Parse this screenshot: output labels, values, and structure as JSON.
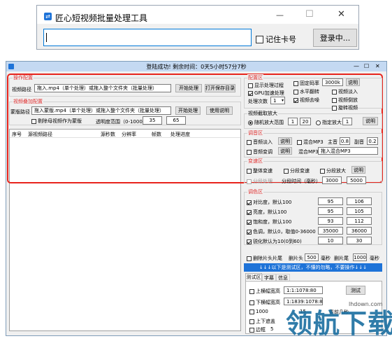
{
  "login_window": {
    "title": "匠心短视频批量处理工具",
    "controls": {
      "minimize": "—",
      "maximize": "☐",
      "close": "✕"
    },
    "card_input_value": "",
    "remember_label": "记住卡号",
    "remember_checked": false,
    "login_button": "登录中..."
  },
  "main_window": {
    "status_title": "登陆成功! 剩余时间：0天5小时57分7秒",
    "single": {
      "title": "操作配置",
      "path_label": "视频路径",
      "path_value": "拖入.mp4（单个处理）或拖入整个文件夹（批量处理）",
      "start_button": "开始处理",
      "open_dir_button": "打开保存目录"
    },
    "overlay": {
      "title": "视频叠加配置",
      "path_label": "蒙版路径",
      "path_value": "拖入蒙版.mp4（单个处理）或拖入整个文件夹（批量处理）",
      "start_button": "开始处理",
      "usage_button": "使用说明",
      "copy_label": "剔除母视频作为蒙版",
      "opacity_label": "透明度范围（0-1000）",
      "opacity_min": "35",
      "opacity_max": "65"
    },
    "table": {
      "columns": [
        "序号",
        "源视频路径",
        "源秒数",
        "分辨率",
        "帧数",
        "处理进度"
      ],
      "rows": []
    },
    "config": {
      "title": "配置区",
      "show_process_label": "显示处理过程",
      "show_process_checked": false,
      "gpu_label": "GPU加速处理",
      "gpu_checked": true,
      "count_label": "处理次数",
      "count_value": "1",
      "fixed_bitrate_label": "固定码率",
      "fixed_bitrate_checked": false,
      "bitrate_value": "3000k",
      "bitrate_help_button": "说明",
      "blur_label": "水平翻转",
      "blur_checked": false,
      "fade_in_label": "视频淡入",
      "fade_in_checked": false,
      "remove_title_label": "视频去噪",
      "remove_title_checked": true,
      "reverse_label": "视频倒放",
      "reverse_checked": false,
      "rotate_label": "旋转视频",
      "rotate_checked": false
    },
    "enlarge": {
      "title": "视频截取放大",
      "random_label": "随机放大范围",
      "random_checked": true,
      "random_min": "1",
      "random_max": "20",
      "fixed_label": "指定放大",
      "fixed_checked": false,
      "fixed_value": "1",
      "help_button": "说明"
    },
    "audio": {
      "title": "调音区",
      "audio_in_label": "音频淡入",
      "audio_in_checked": false,
      "audio_in_help": "说明",
      "mix_label": "混合MP3",
      "mix_checked": false,
      "main_label": "主音",
      "main_value": "0.8",
      "sub_label": "副音",
      "sub_value": "0.2",
      "audio_pitch_label": "音频变调",
      "audio_pitch_checked": false,
      "audio_pitch_help": "说明",
      "mix_mp3_label": "混合MP3",
      "mix_mp3_value": "拖入混合MP3"
    },
    "speed": {
      "title": "变速区",
      "global_label": "整体变速",
      "global_checked": false,
      "segment_label": "分段变速",
      "segment_checked": false,
      "segment_enlarge_label": "分段放大",
      "segment_enlarge_checked": false,
      "help_button": "说明",
      "segment_process_label": "分段处理",
      "segment_time_label": "分段时间（毫秒）",
      "segment_min": "3000",
      "segment_max": "5000"
    },
    "color": {
      "title": "调色区",
      "items": [
        {
          "label": "对比度，默认100",
          "checked": true,
          "min": "95",
          "max": "106"
        },
        {
          "label": "亮度，默认100",
          "checked": true,
          "min": "95",
          "max": "105"
        },
        {
          "label": "饱和度，默认100",
          "checked": true,
          "min": "93",
          "max": "112"
        },
        {
          "label": "色调，默认0，取值0-36000",
          "checked": true,
          "min": "35000",
          "max": "36000"
        },
        {
          "label": "锐化默认为10(0到60)",
          "checked": true,
          "min": "10",
          "max": "30"
        }
      ]
    },
    "trim": {
      "label": "删除片头片尾",
      "checked": false,
      "head_label": "删片头",
      "head_value": "500",
      "head_unit": "毫秒",
      "tail_label": "删片尾",
      "tail_value": "1000",
      "tail_unit": "毫秒"
    },
    "test_banner": "↓↓↓以下是测试区，不懂的勿略，不要操作↓↓↓",
    "test_tabs": [
      "测试区",
      "字幕",
      "信息"
    ],
    "test": {
      "top_label": "上横幅宽高",
      "top_value": "1:1:1078:80",
      "bottom_label": "下横幅宽高",
      "bottom_value": "1:1839:1078:80",
      "test_button": "测试",
      "row3_label": "1000",
      "row3_extra": "15",
      "row3_tail": "素前几秒",
      "row4_label": "上下遮盖",
      "row5_label": "边框",
      "row5_extra": "5"
    },
    "watermark": {
      "brand": "领航下载",
      "url": "lhdown.com"
    }
  },
  "colors": {
    "title_bar": "#c4d9f2",
    "window_bg": "#f0f0f0",
    "highlight": "#e8241c",
    "banner": "#1e73d8",
    "watermark": "#1a6ea0"
  }
}
